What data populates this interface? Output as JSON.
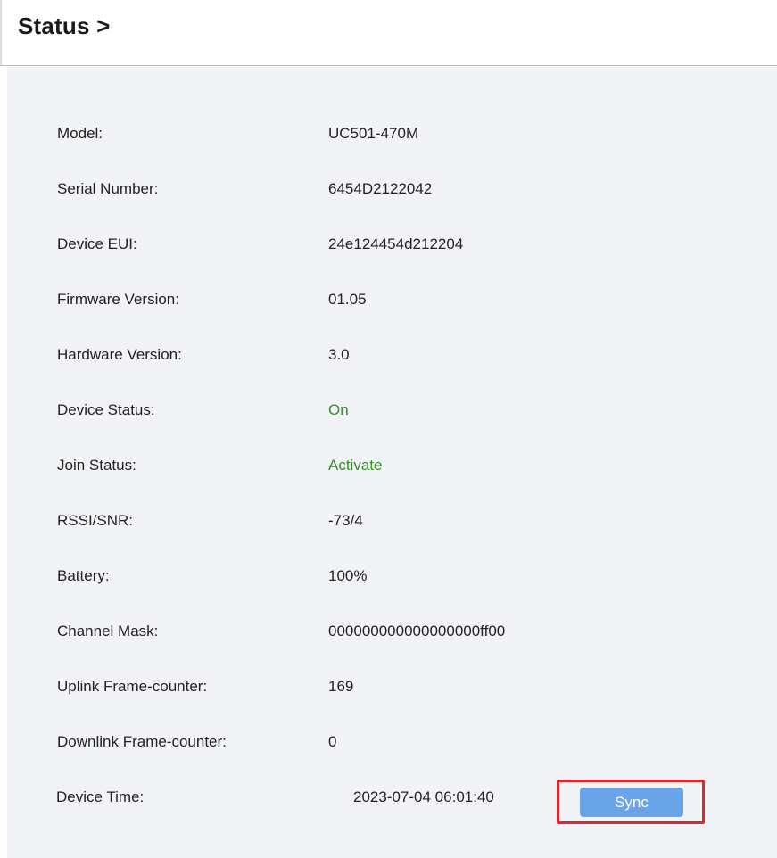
{
  "header": {
    "title": "Status >"
  },
  "fields": [
    {
      "label": "Model:",
      "value": "UC501-470M"
    },
    {
      "label": "Serial Number:",
      "value": "6454D2122042"
    },
    {
      "label": "Device EUI:",
      "value": "24e124454d212204"
    },
    {
      "label": "Firmware Version:",
      "value": "01.05"
    },
    {
      "label": "Hardware Version:",
      "value": "3.0"
    },
    {
      "label": "Device Status:",
      "value": "On"
    },
    {
      "label": "Join Status:",
      "value": "Activate"
    },
    {
      "label": "RSSI/SNR:",
      "value": "-73/4"
    },
    {
      "label": "Battery:",
      "value": "100%"
    },
    {
      "label": "Channel Mask:",
      "value": "000000000000000000ff00"
    },
    {
      "label": "Uplink Frame-counter:",
      "value": "169"
    },
    {
      "label": "Downlink Frame-counter:",
      "value": "0"
    }
  ],
  "device_time": {
    "label": "Device Time:",
    "value": "2023-07-04 06:01:40",
    "sync_label": "Sync"
  },
  "colors": {
    "status_green": "#3c8c2e",
    "sync_button": "#6aa4e8",
    "highlight_red": "#e0262a",
    "panel_background": "#f1f3f6"
  }
}
